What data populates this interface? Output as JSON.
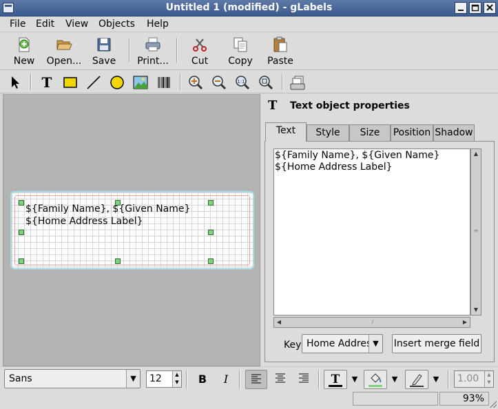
{
  "window": {
    "title": "Untitled 1 (modified) - gLabels"
  },
  "menubar": {
    "items": [
      "File",
      "Edit",
      "View",
      "Objects",
      "Help"
    ]
  },
  "toolbar": {
    "new": "New",
    "open": "Open...",
    "save": "Save",
    "print": "Print...",
    "cut": "Cut",
    "copy": "Copy",
    "paste": "Paste"
  },
  "label_text": {
    "line1": "${Family Name}, ${Given Name}",
    "line2": "${Home Address Label}"
  },
  "panel": {
    "title": "Text object properties",
    "tabs": [
      "Text",
      "Style",
      "Size",
      "Position",
      "Shadow"
    ],
    "active_tab": "Text",
    "text_content": "${Family Name}, ${Given Name}\n${Home Address Label}",
    "key_label": "Key:",
    "key_value": "Home Address Label",
    "insert_button": "Insert merge field"
  },
  "formatbar": {
    "font_family": "Sans",
    "font_size": "12",
    "bold": "B",
    "italic": "I",
    "line_width": "1.00"
  },
  "statusbar": {
    "zoom": "93%"
  }
}
